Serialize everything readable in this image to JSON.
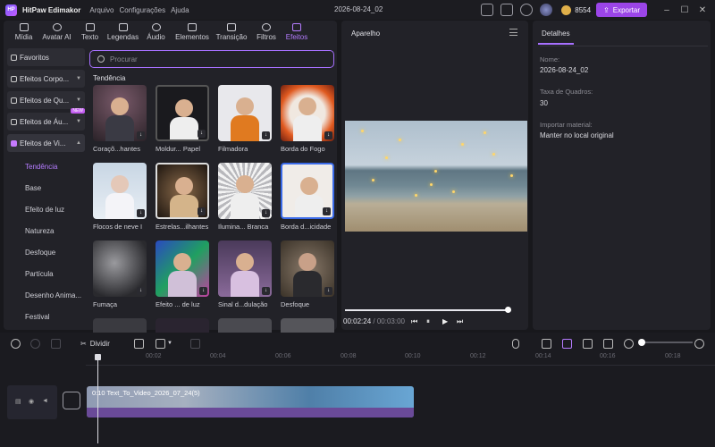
{
  "app": {
    "name": "HitPaw Edimakor",
    "menus": [
      "Arquivo",
      "Configurações",
      "Ajuda"
    ],
    "doc_title": "2026-08-24_02",
    "coins": "8554",
    "export_label": "Exportar"
  },
  "tabs": [
    {
      "label": "Mídia",
      "icon": "media-icon"
    },
    {
      "label": "Avatar AI",
      "icon": "avatar-ai-icon"
    },
    {
      "label": "Texto",
      "icon": "text-icon"
    },
    {
      "label": "Legendas",
      "icon": "subtitles-icon"
    },
    {
      "label": "Áudio",
      "icon": "audio-icon"
    },
    {
      "label": "Elementos",
      "icon": "elements-icon"
    },
    {
      "label": "Transição",
      "icon": "transition-icon"
    },
    {
      "label": "Filtros",
      "icon": "filters-icon"
    },
    {
      "label": "Efeitos",
      "icon": "effects-icon",
      "active": true
    }
  ],
  "sidebar": {
    "categories": [
      "Favoritos",
      "Efeitos Corpo...",
      "Efeitos de Qu...",
      "Efeitos de Áu...",
      "Efeitos de Vi..."
    ],
    "new_badge": "NEW",
    "subitems": [
      "Tendência",
      "Base",
      "Efeito de luz",
      "Natureza",
      "Desfoque",
      "Partícula",
      "Desenho Anima...",
      "Festival"
    ]
  },
  "search": {
    "placeholder": "Procurar"
  },
  "section_title": "Tendência",
  "effects": [
    "Coraçõ...hantes",
    "Moldur... Papel",
    "Filmadora",
    "Borda do Fogo",
    "Flocos de neve I",
    "Estrelas...ilhantes",
    "Ilumina... Branca",
    "Borda d...icidade",
    "Fumaça",
    "Efeito ... de luz",
    "Sinal d...dulação",
    "Desfoque"
  ],
  "player": {
    "title": "Aparelho",
    "current_time": "00:02:24",
    "total_time": "/ 00:03:00",
    "progress": 0.98
  },
  "details": {
    "tab": "Detalhes",
    "name_label": "Nome:",
    "name_value": "2026-08-24_02",
    "fps_label": "Taxa de Quadros:",
    "fps_value": "30",
    "import_label": "Importar material:",
    "import_value": "Manter no local original"
  },
  "timeline": {
    "split_label": "Dividir",
    "ruler": [
      "00:02",
      "00:04",
      "00:06",
      "00:08",
      "00:10",
      "00:12",
      "00:14",
      "00:16",
      "00:18"
    ],
    "clip_name": "0:10 Text_To_Video_2026_07_24(5)"
  },
  "colors": {
    "accent": "#9b45e8",
    "active_tab": "#b57cff",
    "bg": "#18181c"
  }
}
